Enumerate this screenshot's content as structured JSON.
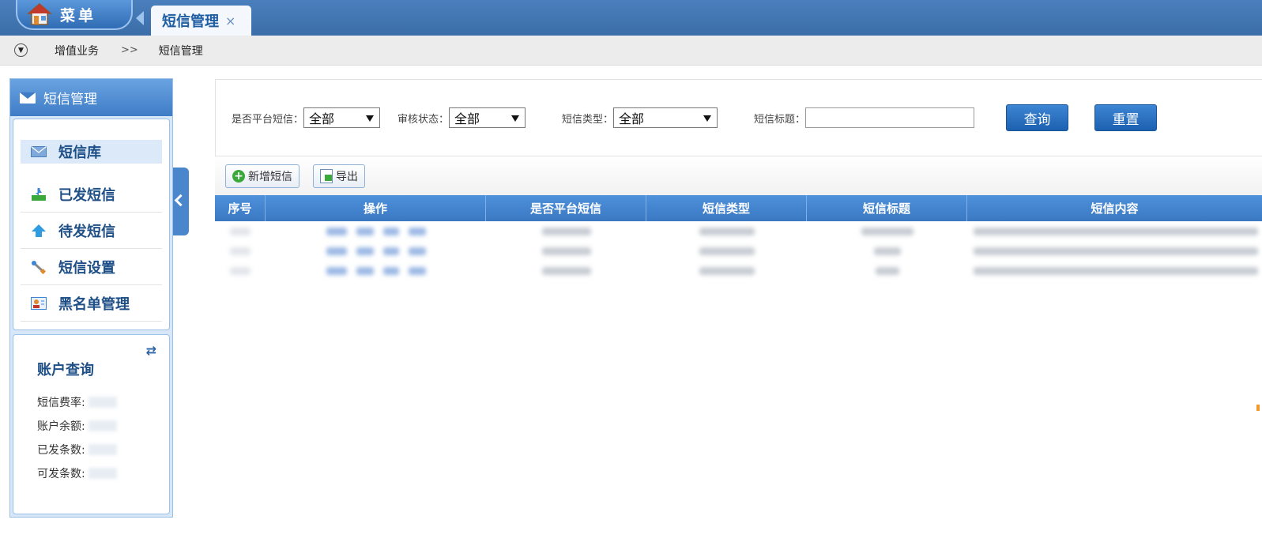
{
  "topbar": {
    "menu_label": "菜单",
    "tab_label": "短信管理",
    "tab_close": "×"
  },
  "breadcrumb": {
    "toggle": "▼",
    "level1": "增值业务",
    "sep": ">>",
    "level2": "短信管理"
  },
  "sidebar": {
    "header": "短信管理",
    "items": [
      {
        "label": "短信库",
        "icon": "envelope-icon",
        "active": true
      },
      {
        "label": "已发短信",
        "icon": "download-tray-icon",
        "active": false
      },
      {
        "label": "待发短信",
        "icon": "up-arrow-icon",
        "active": false
      },
      {
        "label": "短信设置",
        "icon": "wrench-icon",
        "active": false
      },
      {
        "label": "黑名单管理",
        "icon": "id-card-icon",
        "active": false
      }
    ],
    "account": {
      "title": "账户查询",
      "rows": [
        "短信费率:",
        "账户余额:",
        "已发条数:",
        "可发条数:"
      ]
    }
  },
  "search": {
    "platform_label": "是否平台短信：",
    "platform_value": "全部",
    "audit_label": "审核状态：",
    "audit_value": "全部",
    "type_label": "短信类型：",
    "type_value": "全部",
    "title_label": "短信标题：",
    "title_value": "",
    "query_button": "查询",
    "reset_button": "重置"
  },
  "toolbar": {
    "add_label": "新增短信",
    "export_label": "导出"
  },
  "grid": {
    "columns": [
      "序号",
      "操作",
      "是否平台短信",
      "短信类型",
      "短信标题",
      "短信内容"
    ]
  },
  "colors": {
    "header_blue": "#3b6ea8",
    "accent_blue": "#1f5da3",
    "sidebar_bg": "#d7e7f8",
    "grid_header": "#4a86cb"
  }
}
